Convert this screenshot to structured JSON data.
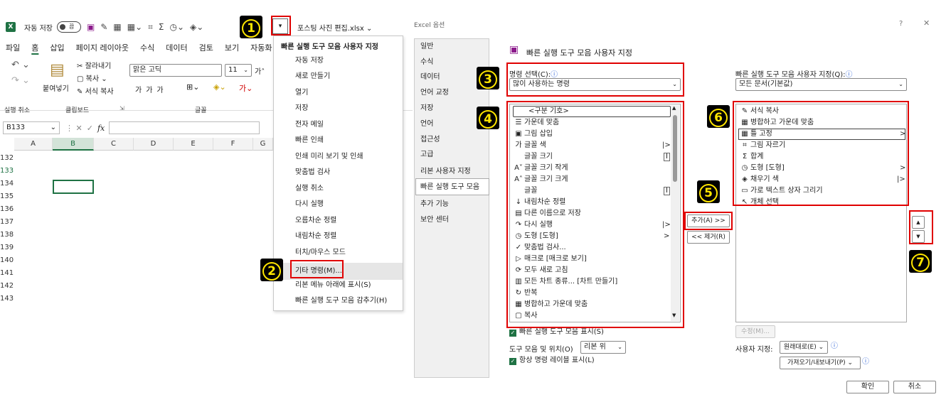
{
  "excel": {
    "autosave_label": "자동 저장",
    "toggle_text": "끔",
    "file_name": "포스팅 사진 편집.xlsx ⌄",
    "menu": [
      "파일",
      "홈",
      "삽입",
      "페이지 레이아웃",
      "수식",
      "데이터",
      "검토",
      "보기",
      "자동화"
    ],
    "ribbon": {
      "undo_group": "실행 취소",
      "paste": "붙여넣기",
      "cut": "잘라내기",
      "copy": "복사",
      "format_painter": "서식 복사",
      "clipboard_group": "클립보드",
      "font_name": "맑은 고딕",
      "font_size": "11",
      "font_group": "글꼴"
    },
    "name_box": "B133",
    "fx": "fx",
    "columns": [
      "A",
      "B",
      "C",
      "D",
      "E",
      "F",
      "G"
    ],
    "rows": [
      "132",
      "133",
      "134",
      "135",
      "136",
      "137",
      "138",
      "139",
      "140",
      "141",
      "142",
      "143"
    ]
  },
  "dropdown": {
    "title": "빠른 실행 도구 모음 사용자 지정",
    "items": [
      "자동 저장",
      "새로 만들기",
      "열기",
      "저장",
      "전자 메일",
      "빠른 인쇄",
      "인쇄 미리 보기 및 인쇄",
      "맞춤법 검사",
      "실행 취소",
      "다시 실행",
      "오름차순 정렬",
      "내림차순 정렬",
      "터치/마우스 모드",
      "기타 명령(M)...",
      "리본 메뉴 아래에 표시(S)",
      "빠른 실행 도구 모음 감추기(H)"
    ]
  },
  "dialog": {
    "title": "Excel 옵션",
    "help": "?",
    "close": "✕",
    "nav": [
      "일반",
      "수식",
      "데이터",
      "언어 교정",
      "저장",
      "언어",
      "접근성",
      "고급",
      "리본 사용자 지정",
      "빠른 실행 도구 모음",
      "추가 기능",
      "보안 센터"
    ],
    "heading": "빠른 실행 도구 모음 사용자 지정",
    "choose_label": "명령 선택(C):",
    "choose_value": "많이 사용하는 명령",
    "customize_label": "빠른 실행 도구 모음 사용자 지정(Q):",
    "customize_value": "모든 문서(기본값)",
    "commands": [
      {
        "icon": "",
        "label": "<구분 기호>",
        "sub": ""
      },
      {
        "icon": "☰",
        "label": "가운데 맞춤",
        "sub": ""
      },
      {
        "icon": "▣",
        "label": "그림 삽입",
        "sub": ""
      },
      {
        "icon": "가",
        "label": "글꼴 색",
        "sub": "|>"
      },
      {
        "icon": "",
        "label": "글꼴 크기",
        "sub": "I"
      },
      {
        "icon": "A˅",
        "label": "글꼴 크기 작게",
        "sub": ""
      },
      {
        "icon": "A˄",
        "label": "글꼴 크기 크게",
        "sub": ""
      },
      {
        "icon": "",
        "label": "글꼴",
        "sub": "I"
      },
      {
        "icon": "↓",
        "label": "내림차순 정렬",
        "sub": ""
      },
      {
        "icon": "▤",
        "label": "다른 이름으로 저장",
        "sub": ""
      },
      {
        "icon": "↷",
        "label": "다시 실행",
        "sub": "|>"
      },
      {
        "icon": "◷",
        "label": "도형 [도형]",
        "sub": ">"
      },
      {
        "icon": "✓",
        "label": "맞춤법 검사...",
        "sub": ""
      },
      {
        "icon": "▷",
        "label": "매크로 [매크로 보기]",
        "sub": ""
      },
      {
        "icon": "⟳",
        "label": "모두 새로 고침",
        "sub": ""
      },
      {
        "icon": "▥",
        "label": "모든 차트 종류... [차트 만들기]",
        "sub": ""
      },
      {
        "icon": "↻",
        "label": "반복",
        "sub": ""
      },
      {
        "icon": "▦",
        "label": "병합하고 가운데 맞춤",
        "sub": ""
      },
      {
        "icon": "▢",
        "label": "복사",
        "sub": ""
      }
    ],
    "toolbar_items": [
      {
        "icon": "✎",
        "label": "서식 복사",
        "sub": ""
      },
      {
        "icon": "▦",
        "label": "병합하고 가운데 맞춤",
        "sub": ""
      },
      {
        "icon": "▦",
        "label": "틀 고정",
        "sub": ">"
      },
      {
        "icon": "⌗",
        "label": "그림 자르기",
        "sub": ""
      },
      {
        "icon": "Σ",
        "label": "합계",
        "sub": ""
      },
      {
        "icon": "◷",
        "label": "도형 [도형]",
        "sub": ">"
      },
      {
        "icon": "◈",
        "label": "채우기 색",
        "sub": "|>"
      },
      {
        "icon": "▭",
        "label": "가로 텍스트 상자 그리기",
        "sub": ""
      },
      {
        "icon": "↖",
        "label": "개체 선택",
        "sub": ""
      }
    ],
    "add_btn": "추가(A) >>",
    "remove_btn": "<< 제거(R)",
    "up": "▲",
    "down": "▼",
    "modify_btn": "수정(M)...",
    "show_qat": "빠른 실행 도구 모음 표시(S)",
    "position_label": "도구 모음 및 위치(O)",
    "position_value": "리본 위",
    "always_labels": "항상 명령 레이블 표시(L)",
    "user_setting": "사용자 지정:",
    "reset_btn": "원래대로(E) ⌄",
    "import_btn": "가져오기/내보내기(P) ⌄",
    "ok": "확인",
    "cancel": "취소"
  },
  "badges": [
    "1",
    "2",
    "3",
    "4",
    "5",
    "6",
    "7"
  ],
  "colors": {
    "highlight": "#e00000",
    "excel_green": "#1f7244",
    "badge_bg": "#000000",
    "badge_fg": "#ffe600"
  }
}
